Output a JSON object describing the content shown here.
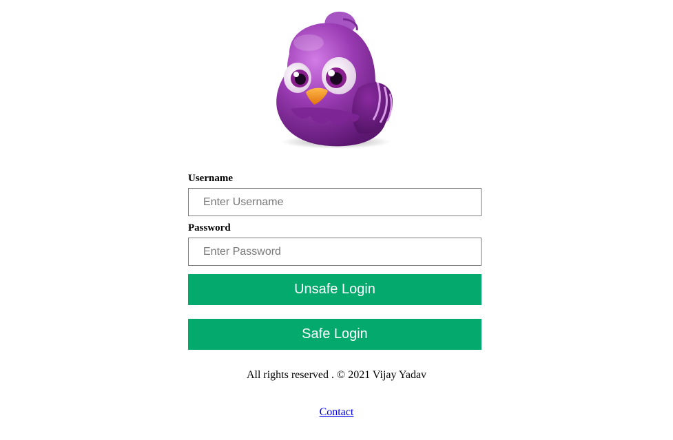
{
  "logo": {
    "icon": "purple-bird-icon"
  },
  "form": {
    "username_label": "Username",
    "username_placeholder": "Enter Username",
    "username_value": "",
    "password_label": "Password",
    "password_placeholder": "Enter Password",
    "password_value": "",
    "unsafe_login_label": "Unsafe Login",
    "safe_login_label": "Safe Login"
  },
  "footer": {
    "copyright": "All rights reserved . © 2021 Vijay Yadav",
    "contact_label": "Contact"
  },
  "colors": {
    "button_bg": "#04aa6d",
    "button_text": "#ffffff",
    "link": "#0000ee",
    "bird_body": "#8e2fa6"
  }
}
